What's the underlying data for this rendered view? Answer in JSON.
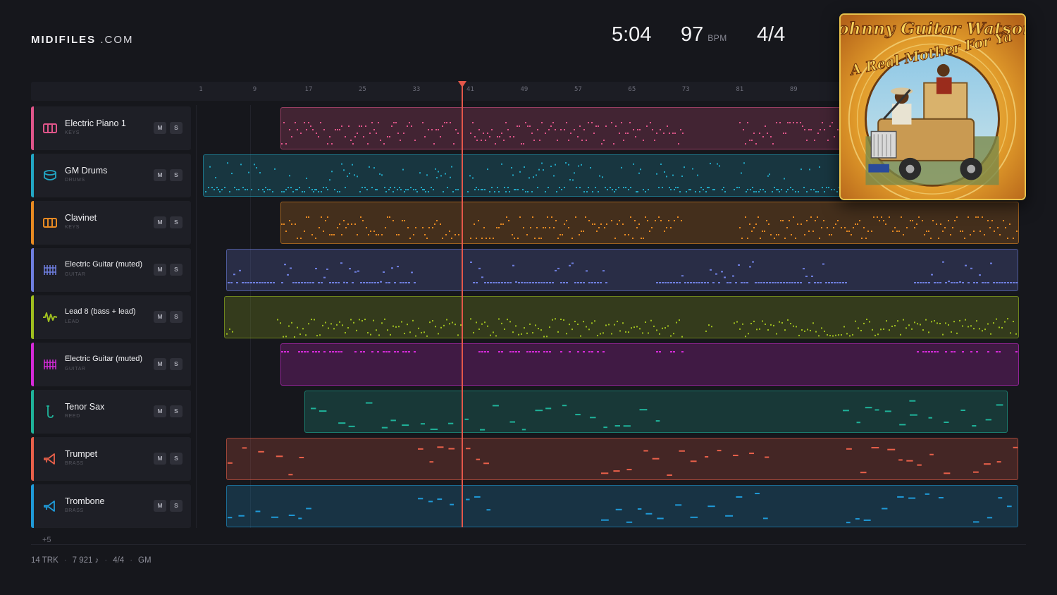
{
  "brand": {
    "name": "MIDIFILES",
    "domain": ".COM"
  },
  "transport": {
    "time": "5:04",
    "tempo": "97",
    "tempo_unit": "BPM",
    "time_signature": "4/4"
  },
  "ruler": {
    "ticks": [
      "1",
      "9",
      "17",
      "25",
      "33",
      "41",
      "49",
      "57",
      "65",
      "73",
      "81",
      "89"
    ]
  },
  "playhead": {
    "bar": 40.3,
    "color": "#e4574a"
  },
  "album": {
    "artist": "Johnny Guitar Watson",
    "title": "A Real Mother For Ya"
  },
  "tracks": [
    {
      "name": "Electric Piano 1",
      "category": "KEYS",
      "icon": "keys-icon",
      "color": "#e0558a",
      "mute": "M",
      "solo": "S"
    },
    {
      "name": "GM Drums",
      "category": "DRUMS",
      "icon": "drum-icon",
      "color": "#22a7c4",
      "mute": "M",
      "solo": "S"
    },
    {
      "name": "Clavinet",
      "category": "KEYS",
      "icon": "keys-icon",
      "color": "#e88a22",
      "mute": "M",
      "solo": "S"
    },
    {
      "name": "Electric Guitar (muted)",
      "category": "GUITAR",
      "icon": "guitar-grid-icon",
      "color": "#6f7fe0",
      "mute": "M",
      "solo": "S"
    },
    {
      "name": "Lead 8 (bass + lead)",
      "category": "LEAD",
      "icon": "wave-icon",
      "color": "#9fbf1f",
      "mute": "M",
      "solo": "S"
    },
    {
      "name": "Electric Guitar (muted)",
      "category": "GUITAR",
      "icon": "guitar-grid-icon",
      "color": "#d52ad8",
      "mute": "M",
      "solo": "S"
    },
    {
      "name": "Tenor Sax",
      "category": "REED",
      "icon": "sax-icon",
      "color": "#1fb39a",
      "mute": "M",
      "solo": "S"
    },
    {
      "name": "Trumpet",
      "category": "BRASS",
      "icon": "horn-icon",
      "color": "#e9604a",
      "mute": "M",
      "solo": "S"
    },
    {
      "name": "Trombone",
      "category": "BRASS",
      "icon": "horn-icon",
      "color": "#1f9ad8",
      "mute": "M",
      "solo": "S"
    }
  ],
  "more_tracks": "+5",
  "footer": {
    "tracks": "14 TRK",
    "notes": "7 921 ♪",
    "signature": "4/4",
    "standard": "GM"
  }
}
